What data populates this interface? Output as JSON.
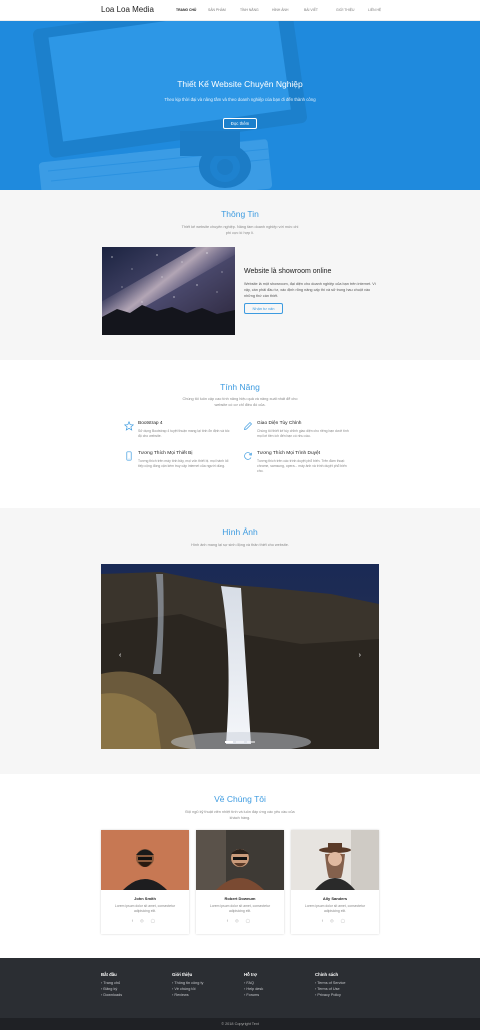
{
  "brand": "Loa Loa Media",
  "nav": [
    {
      "label": "Trang chủ",
      "active": true
    },
    {
      "label": "Sản phẩm"
    },
    {
      "label": "Tính năng"
    },
    {
      "label": "Hình ảnh"
    },
    {
      "label": "Bài viết"
    },
    {
      "label": "Giới thiệu"
    },
    {
      "label": "Liên hệ"
    }
  ],
  "hero": {
    "title": "Thiết Kế Website Chuyên Nghiệp",
    "subtitle": "Theo kịp thời đại và nâng tầm và theo doanh nghiệp của bạn đi đến thành công",
    "button": "Đọc thêm",
    "bg_color": "#2193e8"
  },
  "info": {
    "title": "Thông Tin",
    "subtitle": "Thiết kế website chuyên nghiệp. Nâng tầm doanh nghiệp với mức chi phí cực kì hợp lí.",
    "heading": "Website là showroom online",
    "text": "Website là một showroom, đại diện cho doanh nghiệp của bạn trên internet. Vì vậy, cần phải đầu tư, xác định rõng nâng cấp thì và sử trung hau chuột vào những thứ cần thiết.",
    "button": "Nhận tư vấn"
  },
  "features": {
    "title": "Tính Năng",
    "subtitle": "Chúng tôi luôn cập cao tính năng hiệu quả và nâng xuất nhất để cho website có cơ chỉ điều đó của.",
    "items": [
      {
        "icon": "star-icon",
        "title": "Bootstrap 4",
        "desc": "Sử dụng Bootstrap 4 tuyệt thuận mang lại tính ổn định và tốc độ cho website."
      },
      {
        "icon": "pencil-icon",
        "title": "Giao Diện Tùy Chỉnh",
        "desc": "Chúng tôi thiết kế tùy chỉnh giao diện cho riêng bạn dưới tính mọi lơi tiền ích đến bạn có nhu cầu."
      },
      {
        "icon": "mobile-icon",
        "title": "Tương Thích Mọi Thiết Bị",
        "desc": "Tương thích trên máy tính bảy, mọi vốn thiết bị. mọi hành lối tiếp cộng đồng cận kèm truy cập internet của người dùng."
      },
      {
        "icon": "refresh-icon",
        "title": "Tương Thích Mọi Trình Duyệt",
        "desc": "Tương thích trên các trình duyệt phổ biến. Trên đàm thoại: chrome, samsung, opera... máy ảnh và trình duyệt phổ biến cho."
      }
    ]
  },
  "gallery": {
    "title": "Hình Ảnh",
    "subtitle": "Hình ảnh mang lại sự sinh động và thân thiết cho website.",
    "prev": "‹",
    "next": "›",
    "slide_count": 3,
    "active_slide": 1
  },
  "team": {
    "title": "Về Chúng Tôi",
    "subtitle": "Đội ngũ kỹ thuật viên nhiệt tình và luôn đáp ứng các yêu cầu của khách hàng.",
    "members": [
      {
        "name": "John Smith",
        "desc": "Lorem ipsum dolor sit amet, consectetur adipisicing elit.",
        "social": "f ◎ ◯"
      },
      {
        "name": "Robert Downum",
        "desc": "Lorem ipsum dolor sit amet, consectetur adipisicing elit.",
        "social": "f ◎ ◯"
      },
      {
        "name": "Ally Sanders",
        "desc": "Lorem ipsum dolor sit amet, consectetur adipisicing elit.",
        "social": "f ◎ ◯"
      }
    ]
  },
  "footer": {
    "columns": [
      {
        "title": "Bắt đầu",
        "items": [
          "Trang chủ",
          "Đăng ký",
          "Downloads"
        ]
      },
      {
        "title": "Giới thiệu",
        "items": [
          "Thông tin công ty",
          "Về chúng tôi",
          "Reviews"
        ]
      },
      {
        "title": "Hỗ trợ",
        "items": [
          "FAQ",
          "Help desk",
          "Forums"
        ]
      },
      {
        "title": "Chính sách",
        "items": [
          "Terms of Service",
          "Terms of Use",
          "Privacy Policy"
        ]
      }
    ],
    "copyright": "© 2018 Copyright Text"
  }
}
